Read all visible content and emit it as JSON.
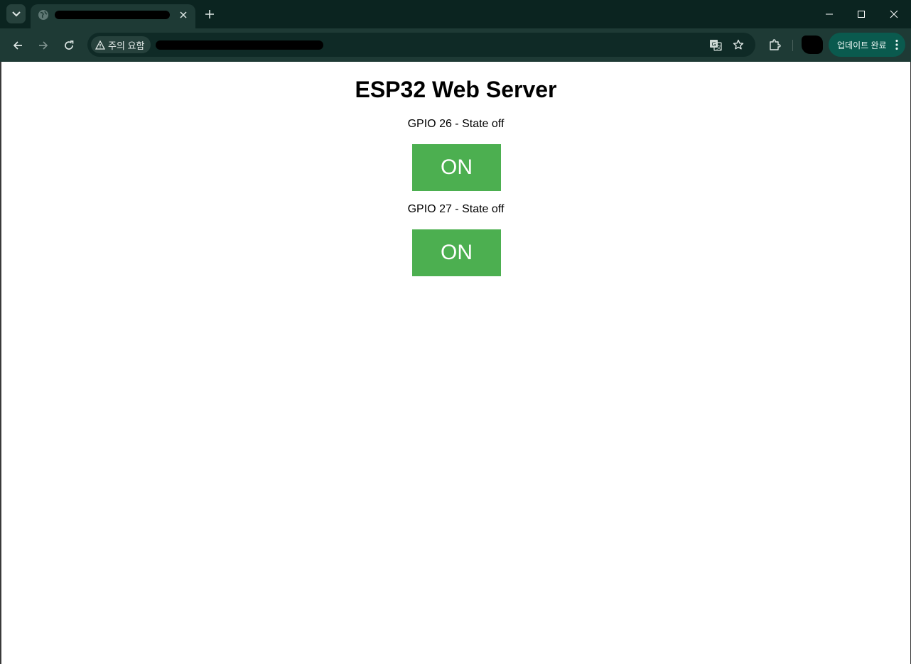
{
  "browser": {
    "security_label": "주의 요함",
    "update_button_label": "업데이트 완료",
    "accent_color": "#0a5a4e",
    "icons": [
      "tab-search-icon",
      "globe-icon",
      "close-icon",
      "plus-icon",
      "minimize-icon",
      "maximize-icon",
      "back-icon",
      "forward-icon",
      "reload-icon",
      "warning-icon",
      "translate-icon",
      "star-icon",
      "extensions-icon",
      "more-icon"
    ]
  },
  "page": {
    "title": "ESP32 Web Server",
    "gpios": [
      {
        "label": "GPIO 26 - State off",
        "button_label": "ON"
      },
      {
        "label": "GPIO 27 - State off",
        "button_label": "ON"
      }
    ],
    "button_color": "#4caf50"
  }
}
